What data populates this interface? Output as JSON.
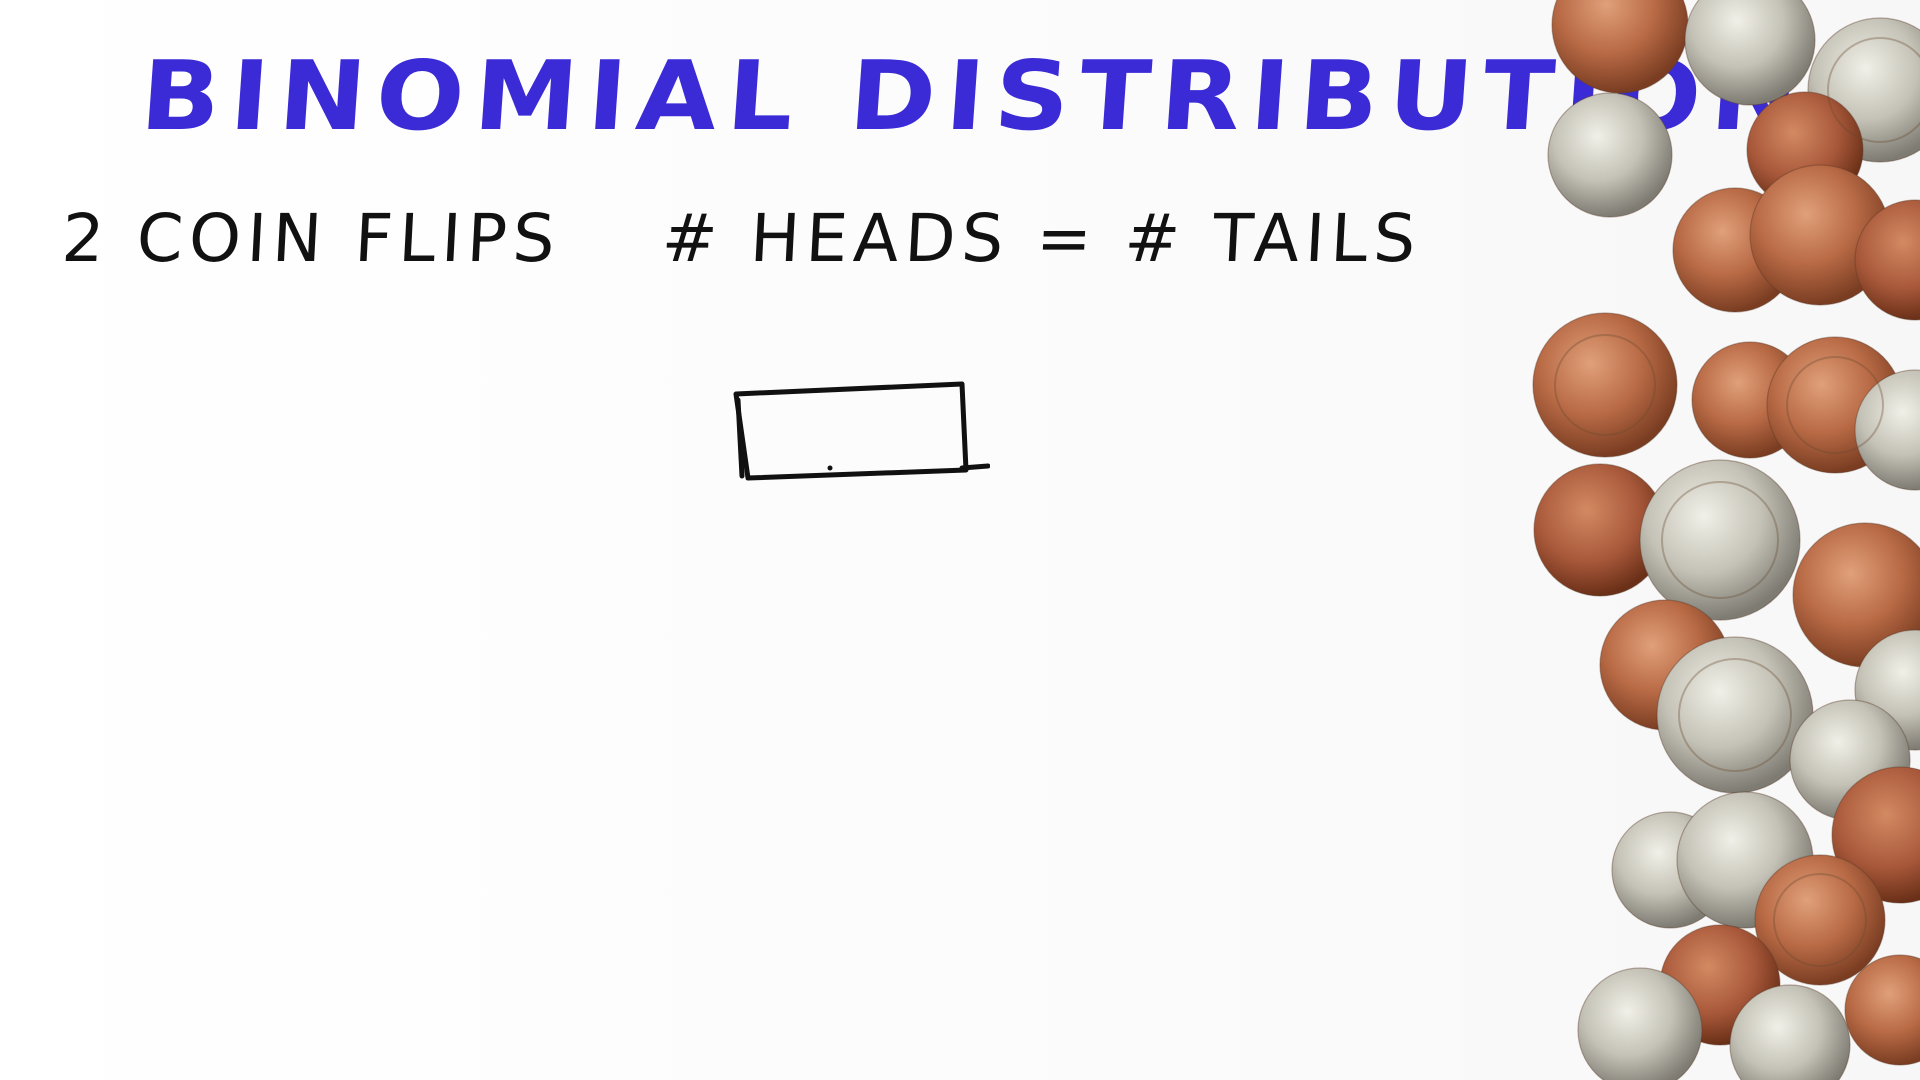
{
  "title": "BINOMIAL DISTRIBUTION",
  "left_note": "2 COIN FLIPS",
  "right_note": "# HEADS = # TAILS",
  "answer_box_value": "",
  "decoration": {
    "coins_icon": "coin-pile",
    "title_color": "#3b2bd6",
    "ink_color": "#111111"
  }
}
